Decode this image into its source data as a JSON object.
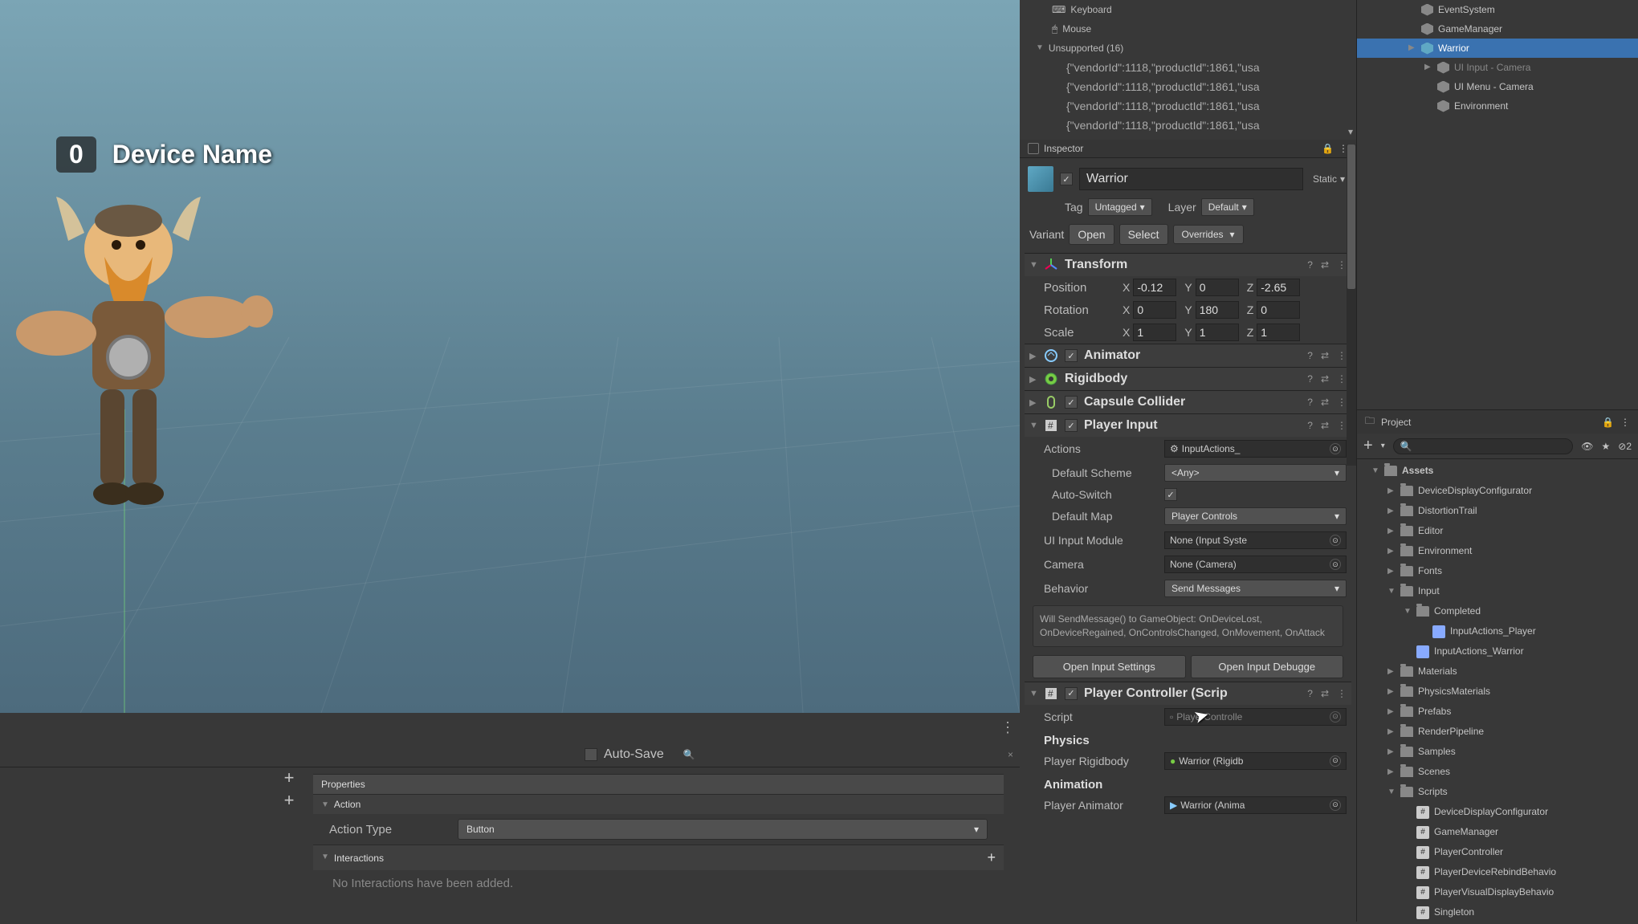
{
  "viewport": {
    "badge": "0",
    "label": "Device Name"
  },
  "bottom": {
    "autoSave": "Auto-Save",
    "propertiesHeader": "Properties",
    "action": {
      "header": "Action",
      "typeLabel": "Action Type",
      "typeValue": "Button"
    },
    "interactions": {
      "header": "Interactions",
      "empty": "No Interactions have been added."
    }
  },
  "devices": {
    "keyboard": "Keyboard",
    "mouse": "Mouse",
    "unsupported": "Unsupported (16)",
    "entries": [
      "{\"vendorId\":1118,\"productId\":1861,\"usa",
      "{\"vendorId\":1118,\"productId\":1861,\"usa",
      "{\"vendorId\":1118,\"productId\":1861,\"usa",
      "{\"vendorId\":1118,\"productId\":1861,\"usa"
    ]
  },
  "inspector": {
    "tab": "Inspector",
    "objectName": "Warrior",
    "static": "Static",
    "tagLabel": "Tag",
    "tagValue": "Untagged",
    "layerLabel": "Layer",
    "layerValue": "Default",
    "variant": "Variant",
    "open": "Open",
    "select": "Select",
    "overrides": "Overrides",
    "transform": {
      "title": "Transform",
      "position": "Position",
      "rotation": "Rotation",
      "scale": "Scale",
      "px": "-0.12",
      "py": "0",
      "pz": "-2.65",
      "rx": "0",
      "ry": "180",
      "rz": "0",
      "sx": "1",
      "sy": "1",
      "sz": "1"
    },
    "animator": "Animator",
    "rigidbody": "Rigidbody",
    "capsule": "Capsule Collider",
    "playerInput": {
      "title": "Player Input",
      "actions": "Actions",
      "actionsValue": "InputActions_",
      "defaultScheme": "Default Scheme",
      "defaultSchemeValue": "<Any>",
      "autoSwitch": "Auto-Switch",
      "defaultMap": "Default Map",
      "defaultMapValue": "Player Controls",
      "uiInputModule": "UI Input Module",
      "uiInputModuleValue": "None (Input Syste",
      "camera": "Camera",
      "cameraValue": "None (Camera)",
      "behavior": "Behavior",
      "behaviorValue": "Send Messages",
      "info": "Will SendMessage() to GameObject: OnDeviceLost, OnDeviceRegained, OnControlsChanged, OnMovement, OnAttack",
      "openInputSettings": "Open Input Settings",
      "openInputDebugger": "Open Input Debugge"
    },
    "playerController": {
      "title": "Player Controller (Scrip",
      "script": "Script",
      "scriptValue": "PlayerControlle",
      "physics": "Physics",
      "playerRigidbody": "Player Rigidbody",
      "playerRigidbodyValue": "Warrior (Rigidb",
      "animation": "Animation",
      "playerAnimator": "Player Animator",
      "playerAnimatorValue": "Warrior (Anima"
    }
  },
  "hierarchy": {
    "items": [
      {
        "label": "EventSystem",
        "cls": ""
      },
      {
        "label": "GameManager",
        "cls": ""
      },
      {
        "label": "Warrior",
        "cls": "sel"
      },
      {
        "label": "UI Input - Camera",
        "cls": "dim"
      },
      {
        "label": "UI Menu - Camera",
        "cls": ""
      },
      {
        "label": "Environment",
        "cls": ""
      }
    ]
  },
  "project": {
    "tab": "Project",
    "assets": "Assets",
    "items": [
      {
        "label": "DeviceDisplayConfigurator",
        "lvl": 2,
        "icon": "folder"
      },
      {
        "label": "DistortionTrail",
        "lvl": 2,
        "icon": "folder"
      },
      {
        "label": "Editor",
        "lvl": 2,
        "icon": "folder"
      },
      {
        "label": "Environment",
        "lvl": 2,
        "icon": "folder"
      },
      {
        "label": "Fonts",
        "lvl": 2,
        "icon": "folder"
      },
      {
        "label": "Input",
        "lvl": 2,
        "icon": "folder",
        "open": true
      },
      {
        "label": "Completed",
        "lvl": 3,
        "icon": "folder",
        "open": true
      },
      {
        "label": "InputActions_Player",
        "lvl": 4,
        "icon": "file"
      },
      {
        "label": "InputActions_Warrior",
        "lvl": 3,
        "icon": "file"
      },
      {
        "label": "Materials",
        "lvl": 2,
        "icon": "folder"
      },
      {
        "label": "PhysicsMaterials",
        "lvl": 2,
        "icon": "folder"
      },
      {
        "label": "Prefabs",
        "lvl": 2,
        "icon": "folder"
      },
      {
        "label": "RenderPipeline",
        "lvl": 2,
        "icon": "folder"
      },
      {
        "label": "Samples",
        "lvl": 2,
        "icon": "folder"
      },
      {
        "label": "Scenes",
        "lvl": 2,
        "icon": "folder"
      },
      {
        "label": "Scripts",
        "lvl": 2,
        "icon": "folder",
        "open": true
      },
      {
        "label": "DeviceDisplayConfigurator",
        "lvl": 3,
        "icon": "cs"
      },
      {
        "label": "GameManager",
        "lvl": 3,
        "icon": "cs"
      },
      {
        "label": "PlayerController",
        "lvl": 3,
        "icon": "cs"
      },
      {
        "label": "PlayerDeviceRebindBehavio",
        "lvl": 3,
        "icon": "cs"
      },
      {
        "label": "PlayerVisualDisplayBehavio",
        "lvl": 3,
        "icon": "cs"
      },
      {
        "label": "Singleton",
        "lvl": 3,
        "icon": "cs"
      }
    ]
  }
}
